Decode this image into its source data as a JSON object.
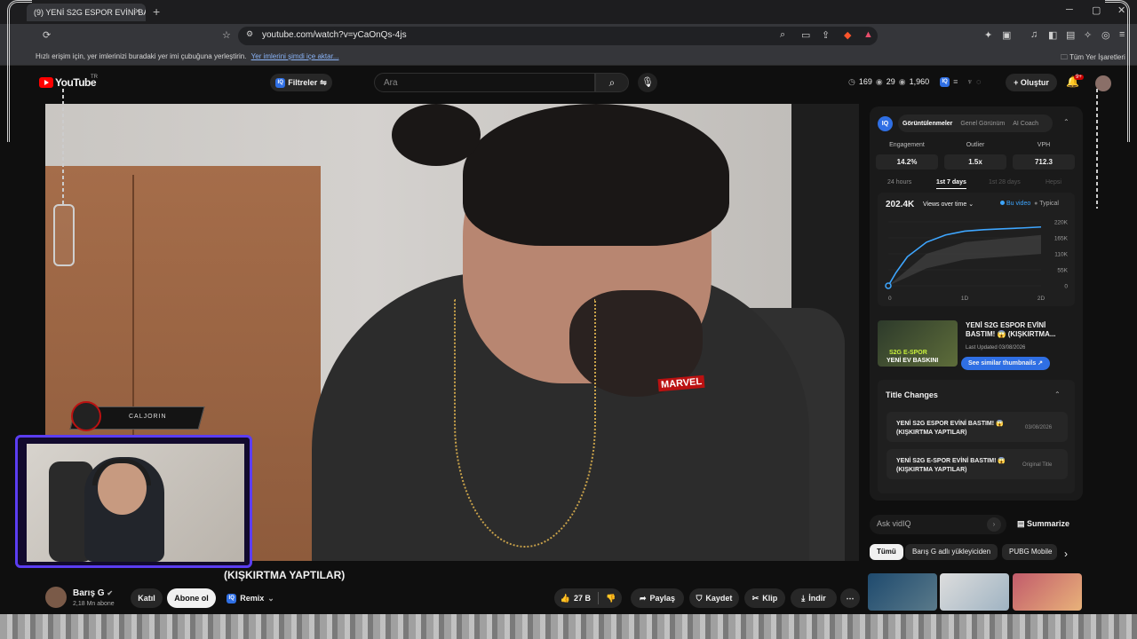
{
  "browser": {
    "tab_title": "(9) YENİ S2G ESPOR EVİNİ BA",
    "url": "youtube.com/watch?v=yCaOnQs-4js",
    "bookmarks_hint": "Hızlı erişim için, yer imlerinizi buradaki yer imi çubuğuna yerleştirin.",
    "bookmarks_link": "Yer imlerini şimdi içe aktar...",
    "all_bookmarks": "Tüm Yer İşaretleri"
  },
  "youtube": {
    "logo": "YouTube",
    "country": "TR",
    "filters_label": "Filtreler",
    "search_placeholder": "Ara",
    "stats": [
      "169",
      "29",
      "1,960"
    ],
    "create_label": "Oluştur",
    "notif_count": "9+"
  },
  "video": {
    "title_fragment": "(KIŞKIRTMA YAPTILAR)",
    "overlay_name": "CALJORIN",
    "channel_name": "Barış G",
    "channel_subs": "2,18 Mn abone",
    "join_label": "Katıl",
    "subscribe_label": "Abone ol",
    "remix_label": "Remix",
    "like_count": "27 B",
    "share_label": "Paylaş",
    "save_label": "Kaydet",
    "clip_label": "Klip",
    "download_label": "İndir"
  },
  "vidiq": {
    "tabs": [
      "Görüntülenmeler",
      "Genel Görünüm",
      "AI Coach"
    ],
    "metrics": [
      {
        "label": "Engagement",
        "value": "14.2%"
      },
      {
        "label": "Outlier",
        "value": "1.5x"
      },
      {
        "label": "VPH",
        "value": "712.3"
      }
    ],
    "ranges": [
      "24 hours",
      "1st 7 days",
      "1st 28 days",
      "Hepsi"
    ],
    "views_total": "202.4K",
    "views_selector": "Views over time",
    "legend_this": "Bu video",
    "legend_typical": "Typical",
    "related_title": "YENİ S2G ESPOR EVİNİ BASTIM! 😱 (KIŞKIRTMA...",
    "related_updated": "Last Updated 03/08/2026",
    "similar_label": "See similar thumbnails",
    "thumb_line1": "S2G E-SPOR",
    "thumb_line2": "YENİ EV BASKINI",
    "title_changes_header": "Title Changes",
    "title_changes": [
      {
        "title": "YENİ S2G ESPOR EVİNİ BASTIM! 😱 (KIŞKIRTMA YAPTILAR)",
        "meta": "03/08/2026"
      },
      {
        "title": "YENİ S2G E-SPOR EVİNİ BASTIM! 😱 (KIŞKIRTMA YAPTILAR)",
        "meta": "Original Title"
      }
    ],
    "ask_placeholder": "Ask vidIQ",
    "summarize_label": "Summarize"
  },
  "chips": [
    "Tümü",
    "Barış G adlı yükleyiciden",
    "PUBG Mobile"
  ],
  "chart_data": {
    "type": "area",
    "x_ticks": [
      "0",
      "1D",
      "2D"
    ],
    "y_ticks": [
      "220K",
      "165K",
      "110K",
      "55K",
      "0"
    ],
    "ylim": [
      0,
      220000
    ],
    "xlim": [
      0,
      2
    ],
    "series": [
      {
        "name": "Bu video",
        "x": [
          0,
          0.1,
          0.25,
          0.5,
          0.75,
          1.0,
          1.25,
          1.5,
          1.75,
          2.0
        ],
        "y": [
          0,
          45000,
          100000,
          150000,
          175000,
          188000,
          193000,
          196000,
          199000,
          202400
        ]
      }
    ],
    "typical_band": {
      "x": [
        0,
        0.5,
        1.0,
        2.0
      ],
      "lower": [
        0,
        60000,
        90000,
        110000
      ],
      "upper": [
        0,
        110000,
        150000,
        175000
      ]
    },
    "colors": {
      "series": "#3ea6ff",
      "band": "#4a4a4a"
    }
  }
}
